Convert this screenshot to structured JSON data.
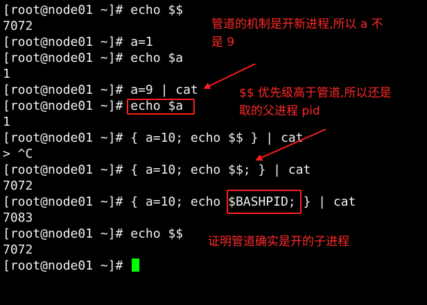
{
  "terminal": {
    "lines": [
      "[root@node01 ~]# echo $$",
      "7072",
      "[root@node01 ~]# a=1",
      "[root@node01 ~]# echo $a",
      "1",
      "[root@node01 ~]# a=9 | cat",
      "[root@node01 ~]# echo $a",
      "1",
      "[root@node01 ~]# { a=10; echo $$ } | cat",
      "> ^C",
      "[root@node01 ~]# { a=10; echo $$; } | cat",
      "7072",
      "[root@node01 ~]# { a=10; echo $BASHPID; } | cat",
      "7083",
      "[root@node01 ~]# echo $$",
      "7072",
      "[root@node01 ~]# "
    ],
    "cursor_color": "#00ff00"
  },
  "annotations": {
    "note1_line1": "管道的机制是开新进程,所以 a 不",
    "note1_line2": "是 9",
    "note2_line1": "$$ 优先级高于管道,所以还是",
    "note2_line2": "取的父进程 pid",
    "note3": "证明管道确实是开的子进程",
    "color": "#ff2a2a"
  }
}
